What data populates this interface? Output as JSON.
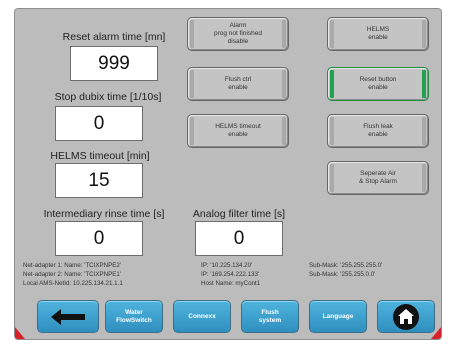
{
  "fields": [
    {
      "id": "reset_alarm_time",
      "label": "Reset alarm time [mn]",
      "value": "999"
    },
    {
      "id": "stop_dubix_time",
      "label": "Stop dubix time [1/10s]",
      "value": "0"
    },
    {
      "id": "helms_timeout",
      "label": "HELMS timeout [min]",
      "value": "15"
    },
    {
      "id": "intermediary_rinse_time",
      "label": "Intermediary rinse time [s]",
      "value": "0"
    },
    {
      "id": "analog_filter_time",
      "label": "Analog filter time [s]",
      "value": "0"
    }
  ],
  "toggle_buttons": [
    {
      "id": "alarm_prog",
      "label": "Alarm\nprog not finished\ndisable",
      "active": false
    },
    {
      "id": "flush_ctrl",
      "label": "Flush ctrl\nenable",
      "active": false
    },
    {
      "id": "helms_timeout_enable",
      "label": "HELMS timeout\nenable",
      "active": false
    },
    {
      "id": "helms_enable",
      "label": "HELMS\nenable",
      "active": false
    },
    {
      "id": "reset_button",
      "label": "Reset button\nenable",
      "active": true
    },
    {
      "id": "flush_leak",
      "label": "Flush leak\nenable",
      "active": false
    },
    {
      "id": "separate_air",
      "label": "Seperate Air\n& Stop Alarm",
      "active": false
    }
  ],
  "network": {
    "adapter1": "Net-adapter 1: Name:  'TCIXPNPE2'",
    "adapter2": "Net-adapter 2: Name:  'TCIXPNPE1'",
    "local_ams": "Local AMS-NetId:  10.225.134.21.1.1",
    "ip1": "IP:  '10.225.134.20'",
    "ip2": "IP:  '169.254.222.133'",
    "host": "Host Name:  myCont1",
    "submask1": "Sub-Mask:  '255.255.255.0'",
    "submask2": "Sub-Mask:  '255.255.0.0'"
  },
  "nav": {
    "back_icon": "arrow-left-icon",
    "water_flowswitch": "Water\nFlowSwitch",
    "connexx": "Connexx",
    "flush_system": "Flush\nsystem",
    "language": "Language",
    "home_icon": "home-icon"
  },
  "colors": {
    "panel_bg": "#bcbcbc",
    "nav_blue": "#3aa0cf",
    "active_green": "#23a150",
    "corner_red": "#d6202a"
  }
}
